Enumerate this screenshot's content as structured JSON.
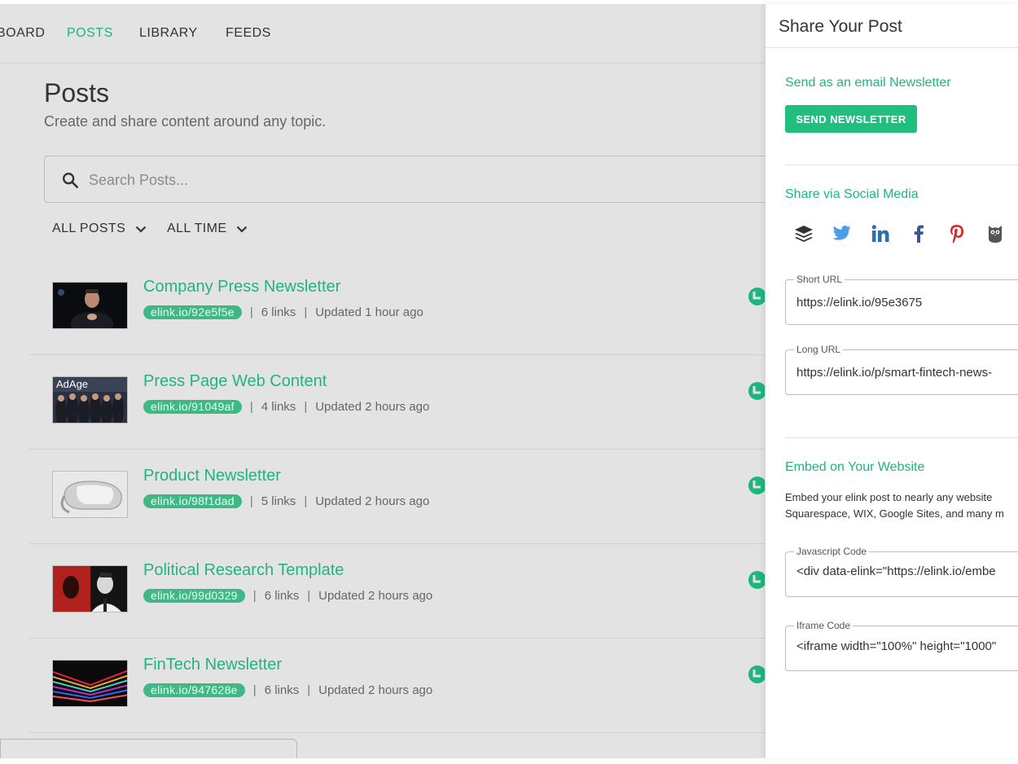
{
  "nav": {
    "items": [
      {
        "label": "BOARD",
        "active": false
      },
      {
        "label": "POSTS",
        "active": true
      },
      {
        "label": "LIBRARY",
        "active": false
      },
      {
        "label": "FEEDS",
        "active": false
      }
    ]
  },
  "page": {
    "title": "Posts",
    "subtitle": "Create and share content around any topic."
  },
  "search": {
    "placeholder": "Search Posts..."
  },
  "filters": [
    {
      "label": "ALL POSTS"
    },
    {
      "label": "ALL TIME"
    }
  ],
  "posts": [
    {
      "title": "Company Press Newsletter",
      "link": "elink.io/92e5f5e",
      "links": "6 links",
      "updated": "Updated 1 hour ago"
    },
    {
      "title": "Press Page Web Content",
      "link": "elink.io/91049af",
      "links": "4 links",
      "updated": "Updated 2 hours ago",
      "thumb_text": "AdAge"
    },
    {
      "title": "Product Newsletter",
      "link": "elink.io/98f1dad",
      "links": "5 links",
      "updated": "Updated 2 hours ago"
    },
    {
      "title": "Political Research Template",
      "link": "elink.io/99d0329",
      "links": "6 links",
      "updated": "Updated 2 hours ago"
    },
    {
      "title": "FinTech Newsletter",
      "link": "elink.io/947628e",
      "links": "6 links",
      "updated": "Updated 2 hours ago"
    }
  ],
  "panel": {
    "title": "Share Your Post",
    "newsletter": {
      "heading": "Send as an email Newsletter",
      "button": "SEND NEWSLETTER"
    },
    "social": {
      "heading": "Share via Social Media",
      "icons": [
        "buffer-icon",
        "twitter-icon",
        "linkedin-icon",
        "facebook-icon",
        "pinterest-icon",
        "hootsuite-icon"
      ]
    },
    "short_url": {
      "label": "Short URL",
      "value": "https://elink.io/95e3675"
    },
    "long_url": {
      "label": "Long URL",
      "value": "https://elink.io/p/smart-fintech-news-"
    },
    "embed": {
      "heading": "Embed on Your Website",
      "desc_line1": "Embed your elink post to nearly any website",
      "desc_line2": "Squarespace, WIX, Google Sites, and many m",
      "js_label": "Javascript Code",
      "js_value": "<div data-elink=\"https://elink.io/embe",
      "iframe_label": "Iframe Code",
      "iframe_value": "<iframe width=\"100%\" height=\"1000\""
    }
  },
  "colors": {
    "accent": "#1fb57e",
    "background": "#e3e3e3",
    "badge": "#3fb885",
    "button": "#20bf7f"
  }
}
